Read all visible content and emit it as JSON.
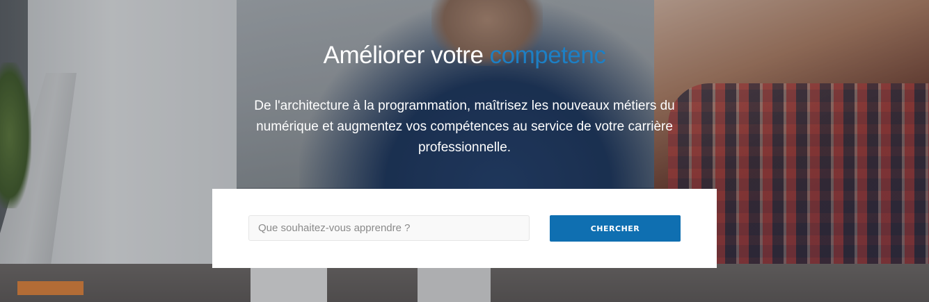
{
  "hero": {
    "title_main": "Améliorer votre",
    "title_accent": "competenc",
    "subtitle": "De l'architecture à la programmation, maîtrisez les nouveaux métiers du numérique et augmentez vos compétences au service de votre carrière professionnelle."
  },
  "search": {
    "placeholder": "Que souhaitez-vous apprendre ?",
    "value": "",
    "button_label": "CHERCHER"
  },
  "colors": {
    "accent": "#1d7fc4",
    "button": "#0f6fb1"
  }
}
